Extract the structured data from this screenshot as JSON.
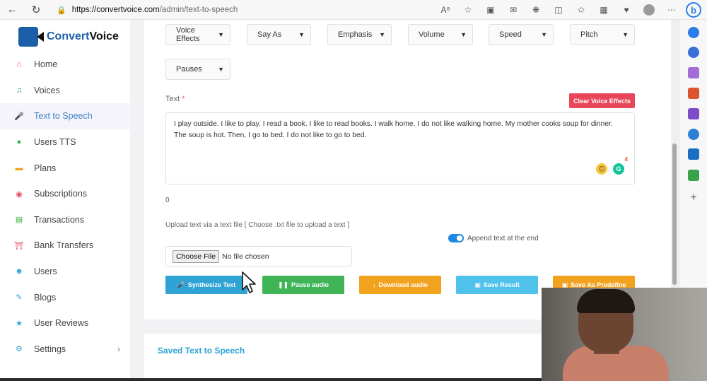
{
  "browser": {
    "url_host": "https://convertvoice.com",
    "url_path": "/admin/text-to-speech"
  },
  "app": {
    "logo_part1": "Convert",
    "logo_part2": "Voice"
  },
  "sidebar": {
    "items": [
      {
        "label": "Home",
        "icon": "home-icon",
        "color": "#e24a5a"
      },
      {
        "label": "Voices",
        "icon": "music-note-icon",
        "color": "#1ca59a"
      },
      {
        "label": "Text to Speech",
        "icon": "microphone-icon",
        "color": "#3d84c6"
      },
      {
        "label": "Users TTS",
        "icon": "chat-bubble-icon",
        "color": "#34b24a"
      },
      {
        "label": "Plans",
        "icon": "credit-card-icon",
        "color": "#f2a21e"
      },
      {
        "label": "Subscriptions",
        "icon": "subscription-icon",
        "color": "#e24a5a"
      },
      {
        "label": "Transactions",
        "icon": "transaction-icon",
        "color": "#34b24a"
      },
      {
        "label": "Bank Transfers",
        "icon": "bank-icon",
        "color": "#e24a5a"
      },
      {
        "label": "Users",
        "icon": "users-icon",
        "color": "#2ea3d4"
      },
      {
        "label": "Blogs",
        "icon": "blog-icon",
        "color": "#2ea3d4"
      },
      {
        "label": "User Reviews",
        "icon": "star-icon",
        "color": "#2ea3d4"
      },
      {
        "label": "Settings",
        "icon": "gear-icon",
        "color": "#2ea3d4"
      }
    ]
  },
  "form": {
    "selects": [
      "Voice Effects",
      "Say As",
      "Emphasis",
      "Volume",
      "Speed",
      "Pitch",
      "Pauses"
    ],
    "text_label": "Text",
    "required_mark": "*",
    "clear_button": "Clear Voice Effects",
    "text_value": "I play outside. I like to play. I read a book. I like to read books. I walk home. I do not like walking home. My mother cooks soup for dinner. The soup is hot. Then, I go to bed. I do not like to go to bed.",
    "char_count": "0",
    "upload_label": "Upload text via a text file [ Choose .txt file to upload a text ]",
    "file_button": "Choose File",
    "file_status": "No file chosen",
    "append_label": "Append text at the end",
    "append_checked": true,
    "grammarly_badge": "4"
  },
  "actions": [
    {
      "label": "Synthesize Text",
      "icon": "microphone-icon",
      "color": "#2ea3d4"
    },
    {
      "label": "Pause audio",
      "icon": "pause-icon",
      "color": "#3fb558"
    },
    {
      "label": "Download audio",
      "icon": "download-arrow-icon",
      "color": "#f2a21e"
    },
    {
      "label": "Save Result",
      "icon": "save-icon",
      "color": "#4fc2ec"
    },
    {
      "label": "Save As Predefine",
      "icon": "save-icon",
      "color": "#f2a21e"
    }
  ],
  "saved": {
    "title": "Saved Text to Speech"
  }
}
